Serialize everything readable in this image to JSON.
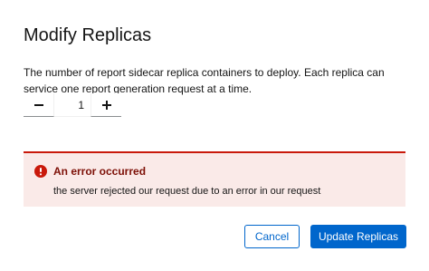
{
  "modal": {
    "title": "Modify Replicas",
    "description": "The number of report sidecar replica containers to deploy. Each replica can service one report generation request at a time."
  },
  "stepper": {
    "minus_icon": "minus-icon",
    "plus_icon": "plus-icon",
    "value": "1"
  },
  "alert": {
    "icon": "exclamation-circle-icon",
    "title": "An error occurred",
    "message": "the server rejected our request due to an error in our request",
    "colors": {
      "accent": "#c9190b",
      "background": "#faeae8",
      "title": "#7d1007"
    }
  },
  "footer": {
    "cancel_label": "Cancel",
    "submit_label": "Update Replicas"
  },
  "colors": {
    "primary": "#0066cc"
  }
}
